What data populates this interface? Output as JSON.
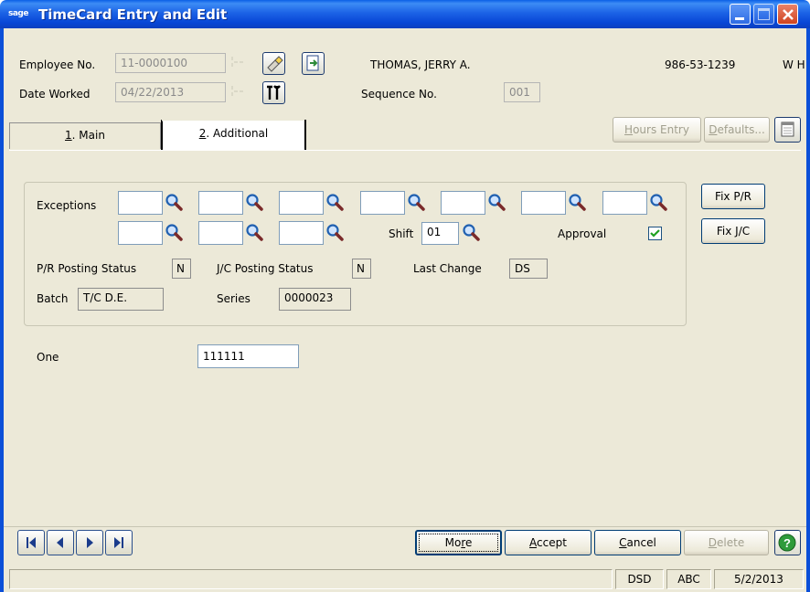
{
  "window": {
    "app_logo": "sage",
    "title": "TimeCard Entry and Edit"
  },
  "header": {
    "employee_label": "Employee No.",
    "employee_value": "11-0000100",
    "employee_name": "THOMAS, JERRY A.",
    "ssn": "986-53-1239",
    "extra": "W H",
    "date_label": "Date Worked",
    "date_value": "04/22/2013",
    "sequence_label": "Sequence No.",
    "sequence_value": "001"
  },
  "tabs": [
    {
      "key": "1",
      "label": ". Main"
    },
    {
      "key": "2",
      "label": ". Additional"
    }
  ],
  "toolbar": {
    "hours_entry_first": "H",
    "hours_entry_rest": "ours Entry",
    "defaults_first": "D",
    "defaults_rest": "efaults..."
  },
  "additional": {
    "exceptions_label": "Exceptions",
    "shift_label": "Shift",
    "shift_value": "01",
    "approval_label": "Approval",
    "approval_checked": true,
    "pr_status_label": "P/R Posting Status",
    "pr_status_value": "N",
    "jc_status_label": "J/C Posting Status",
    "jc_status_value": "N",
    "last_change_label": "Last Change",
    "last_change_value": "DS",
    "batch_label": "Batch",
    "batch_value": "T/C D.E.",
    "series_label": "Series",
    "series_value": "0000023",
    "fix_pr_label": "Fix P/R",
    "fix_jc_label": "Fix J/C",
    "one_label": "One",
    "one_value": "111111"
  },
  "footer": {
    "more_first": "Mo",
    "more_u": "r",
    "more_rest": "e",
    "accept_first": "A",
    "accept_rest": "ccept",
    "cancel_first": "C",
    "cancel_rest": "ancel",
    "delete_first": "D",
    "delete_rest": "elete"
  },
  "status": {
    "company": "DSD",
    "user": "ABC",
    "date": "5/2/2013"
  },
  "colors": {
    "title_blue": "#0846d6",
    "window_bg": "#ece9d8",
    "help_green": "#2e9b3a"
  }
}
